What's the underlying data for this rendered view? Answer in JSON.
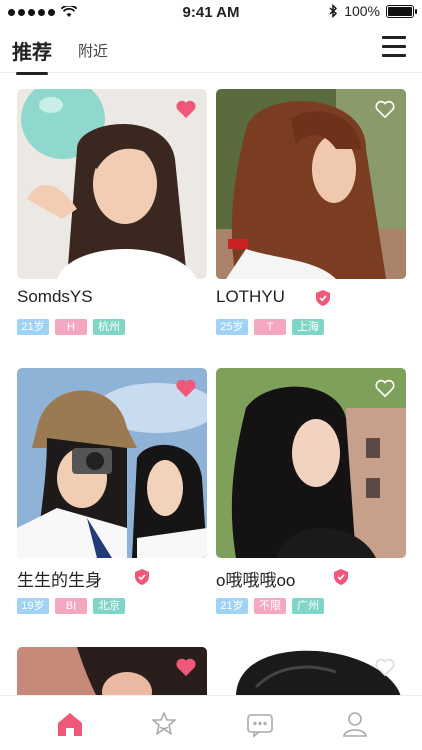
{
  "status_bar": {
    "time": "9:41 AM",
    "battery": "100%"
  },
  "nav": {
    "tabs": [
      {
        "label": "推荐"
      },
      {
        "label": "附近"
      }
    ]
  },
  "cards": [
    {
      "name": "SomdsYS",
      "tags": [
        "21岁",
        "H",
        "杭州"
      ],
      "liked": true,
      "verified": false
    },
    {
      "name": "LOTHYU",
      "tags": [
        "25岁",
        "T",
        "上海"
      ],
      "liked": false,
      "verified": true
    },
    {
      "name": "生生的生身",
      "tags": [
        "19岁",
        "BI",
        "北京"
      ],
      "liked": true,
      "verified": true
    },
    {
      "name": "o哦哦哦oo",
      "tags": [
        "21岁",
        "不限",
        "广州"
      ],
      "liked": false,
      "verified": true
    }
  ],
  "colors": {
    "accent": "#f0587a",
    "age_tag": "#9fd2f4",
    "sex_tag": "#f5a7bf",
    "city_tag": "#7fd5c6"
  },
  "tabbar_icons": [
    "home-icon",
    "star-badge-icon",
    "message-icon",
    "profile-icon"
  ]
}
